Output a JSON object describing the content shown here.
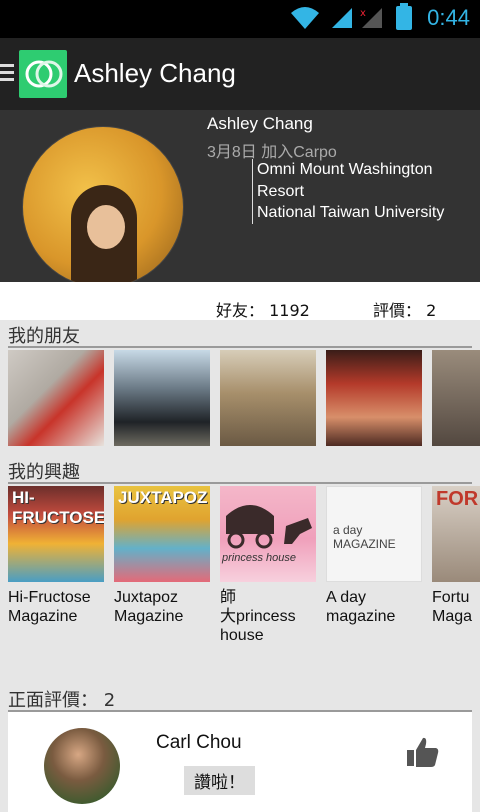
{
  "status_bar": {
    "time": "0:44"
  },
  "app_bar": {
    "title": "Ashley Chang"
  },
  "profile": {
    "name": "Ashley Chang",
    "joined": "3月8日  加入Carpo",
    "info_lines": [
      "Omni Mount Washington",
      "Resort",
      "National Taiwan University"
    ],
    "friends_text": "好友： 1192",
    "rating_text": "評價： 2"
  },
  "sections": {
    "friends_title": "我的朋友",
    "interests_title": "我的興趣",
    "reviews_title": "正面評價： 2"
  },
  "interests": [
    {
      "cover_text": "HI-FRUCTOSE",
      "caption": "Hi-Fructose\nMagazine"
    },
    {
      "cover_text": "JUXTAPOZ",
      "caption": "Juxtapoz\nMagazine"
    },
    {
      "cover_text": "princess house",
      "caption": "師\n大princess\nhouse"
    },
    {
      "cover_text": "a day MAGAZINE",
      "caption": "A day\nmagazine"
    },
    {
      "cover_text": "FOR",
      "caption": "Fortu\nMaga"
    }
  ],
  "review": {
    "name": "Carl Chou",
    "comment": "讚啦！"
  },
  "colors": {
    "accent": "#33b5e5",
    "logo": "#2ecc71"
  }
}
